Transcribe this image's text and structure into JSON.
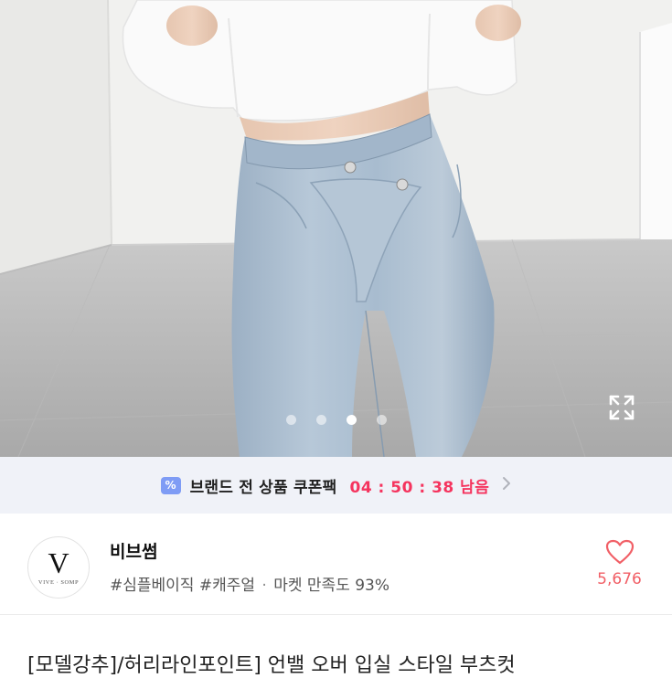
{
  "gallery": {
    "slide_count": 4,
    "active_index": 2
  },
  "coupon": {
    "icon": "coupon-percent-icon",
    "icon_glyph": "%",
    "label": "브랜드 전 상품 쿠폰팩",
    "timer": "04 : 50 : 38 남음",
    "accent_color": "#f5345e"
  },
  "seller": {
    "logo_letter": "V",
    "logo_subtext": "VIVE · SOMP",
    "name": "비브썸",
    "tags": "#심플베이직 #캐주얼",
    "separator": "·",
    "satisfaction": "마켓 만족도 93%"
  },
  "like": {
    "icon": "heart-outline-icon",
    "count": "5,676",
    "color": "#f15f66"
  },
  "product": {
    "title": "[모델강추]/허리라인포인트] 언밸 오버 입실 스타일 부츠컷"
  }
}
